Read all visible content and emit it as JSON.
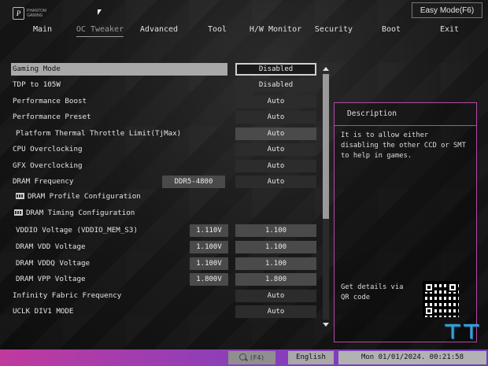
{
  "header": {
    "logo_text": "PHANTOM GAMING",
    "easy_mode_label": "Easy Mode(F6)"
  },
  "nav": {
    "tabs": [
      "Main",
      "OC Tweaker",
      "Advanced",
      "Tool",
      "H/W Monitor",
      "Security",
      "Boot",
      "Exit"
    ],
    "active": "OC Tweaker"
  },
  "settings": {
    "rows": [
      {
        "label": "Gaming Mode",
        "value": "Disabled"
      },
      {
        "label": "TDP to 105W",
        "value": "Disabled"
      },
      {
        "label": "Performance Boost",
        "value": "Auto"
      },
      {
        "label": "Performance Preset",
        "value": "Auto"
      },
      {
        "label": "Platform Thermal Throttle Limit(TjMax)",
        "value": "Auto"
      },
      {
        "label": "CPU Overclocking",
        "value": "Auto"
      },
      {
        "label": "GFX Overclocking",
        "value": "Auto"
      },
      {
        "label": "DRAM Frequency",
        "current": "DDR5-4800",
        "value": "Auto"
      },
      {
        "label": "DRAM Profile Configuration"
      },
      {
        "label": "DRAM Timing Configuration"
      },
      {
        "label": "VDDIO Voltage (VDDIO_MEM_S3)",
        "current": "1.110V",
        "value": "1.100"
      },
      {
        "label": "DRAM VDD Voltage",
        "current": "1.100V",
        "value": "1.100"
      },
      {
        "label": "DRAM VDDQ Voltage",
        "current": "1.100V",
        "value": "1.100"
      },
      {
        "label": "DRAM VPP Voltage",
        "current": "1.800V",
        "value": "1.800"
      },
      {
        "label": "Infinity Fabric Frequency",
        "value": "Auto"
      },
      {
        "label": "UCLK DIV1 MODE",
        "value": "Auto"
      }
    ]
  },
  "description": {
    "title": "Description",
    "text": "It is to allow either disabling the other CCD or SMT to help in games.",
    "qr_text": "Get details via QR code"
  },
  "footer": {
    "search_label": "(F4)",
    "language": "English",
    "datetime": "Mon 01/01/2024. 00:21:58"
  },
  "colors": {
    "accent_border": "#b44aa8",
    "bottombar_start": "#c03a9e",
    "bottombar_end": "#6f3cc0",
    "selected_row": "#a9a9a9"
  }
}
